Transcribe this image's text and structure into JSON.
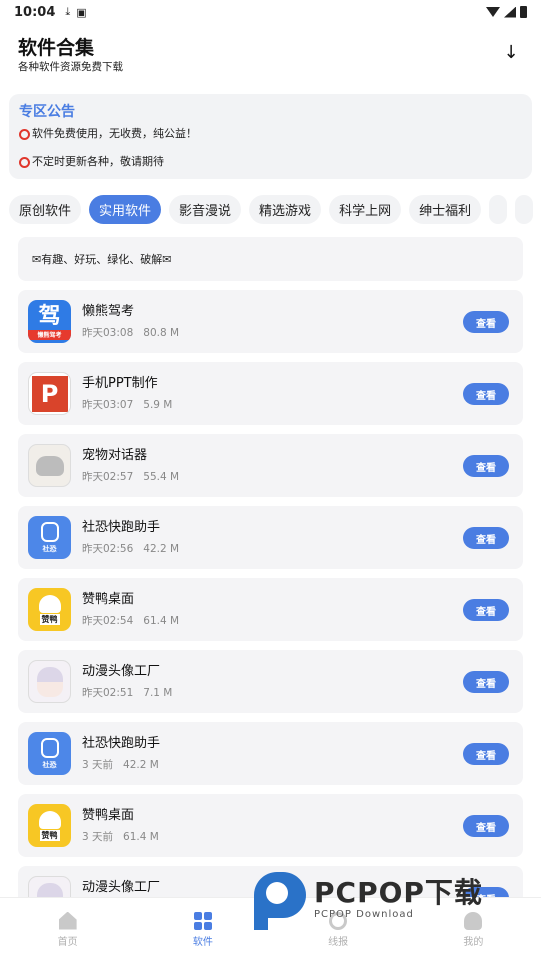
{
  "status_bar": {
    "time": "10:04"
  },
  "header": {
    "title": "软件合集",
    "subtitle": "各种软件资源免费下载"
  },
  "notice": {
    "title": "专区公告",
    "lines": [
      "软件免费使用，无收费，纯公益！",
      "不定时更新各种，敬请期待"
    ]
  },
  "tabs": [
    "原创软件",
    "实用软件",
    "影音漫说",
    "精选游戏",
    "科学上网",
    "绅士福利"
  ],
  "active_tab": "实用软件",
  "banner": "✉有趣、好玩、绿化、破解✉",
  "items": [
    {
      "name": "懒熊驾考",
      "time": "昨天03:08",
      "size": "80.8 M",
      "icon": "jiakao-app-icon",
      "icon_text": "驾",
      "icon_sub": "懒熊驾考",
      "button": "查看"
    },
    {
      "name": "手机PPT制作",
      "time": "昨天03:07",
      "size": "5.9 M",
      "icon": "ppt-app-icon",
      "icon_text": "P",
      "button": "查看"
    },
    {
      "name": "宠物对话器",
      "time": "昨天02:57",
      "size": "55.4 M",
      "icon": "pet-app-icon",
      "button": "查看"
    },
    {
      "name": "社恐快跑助手",
      "time": "昨天02:56",
      "size": "42.2 M",
      "icon": "shekong-app-icon",
      "icon_sub": "社恐",
      "button": "查看"
    },
    {
      "name": "赞鸭桌面",
      "time": "昨天02:54",
      "size": "61.4 M",
      "icon": "duck-app-icon",
      "icon_sub": "赞鸭",
      "button": "查看"
    },
    {
      "name": "动漫头像工厂",
      "time": "昨天02:51",
      "size": "7.1 M",
      "icon": "anime-app-icon",
      "button": "查看"
    },
    {
      "name": "社恐快跑助手",
      "time": "3 天前",
      "size": "42.2 M",
      "icon": "shekong-app-icon",
      "icon_sub": "社恐",
      "button": "查看"
    },
    {
      "name": "赞鸭桌面",
      "time": "3 天前",
      "size": "61.4 M",
      "icon": "duck-app-icon",
      "icon_sub": "赞鸭",
      "button": "查看"
    },
    {
      "name": "动漫头像工厂",
      "time": "",
      "size": "",
      "icon": "anime-app-icon",
      "button": "查看"
    }
  ],
  "nav": [
    {
      "label": "首页",
      "icon": "home-icon"
    },
    {
      "label": "软件",
      "icon": "grid-icon",
      "active": true
    },
    {
      "label": "线报",
      "icon": "clue-icon"
    },
    {
      "label": "我的",
      "icon": "profile-icon"
    }
  ],
  "watermark": {
    "main": "PCPOP下载",
    "sub": "PCPOP Download"
  },
  "colors": {
    "accent": "#4a7de2",
    "card": "#f4f4f6"
  }
}
